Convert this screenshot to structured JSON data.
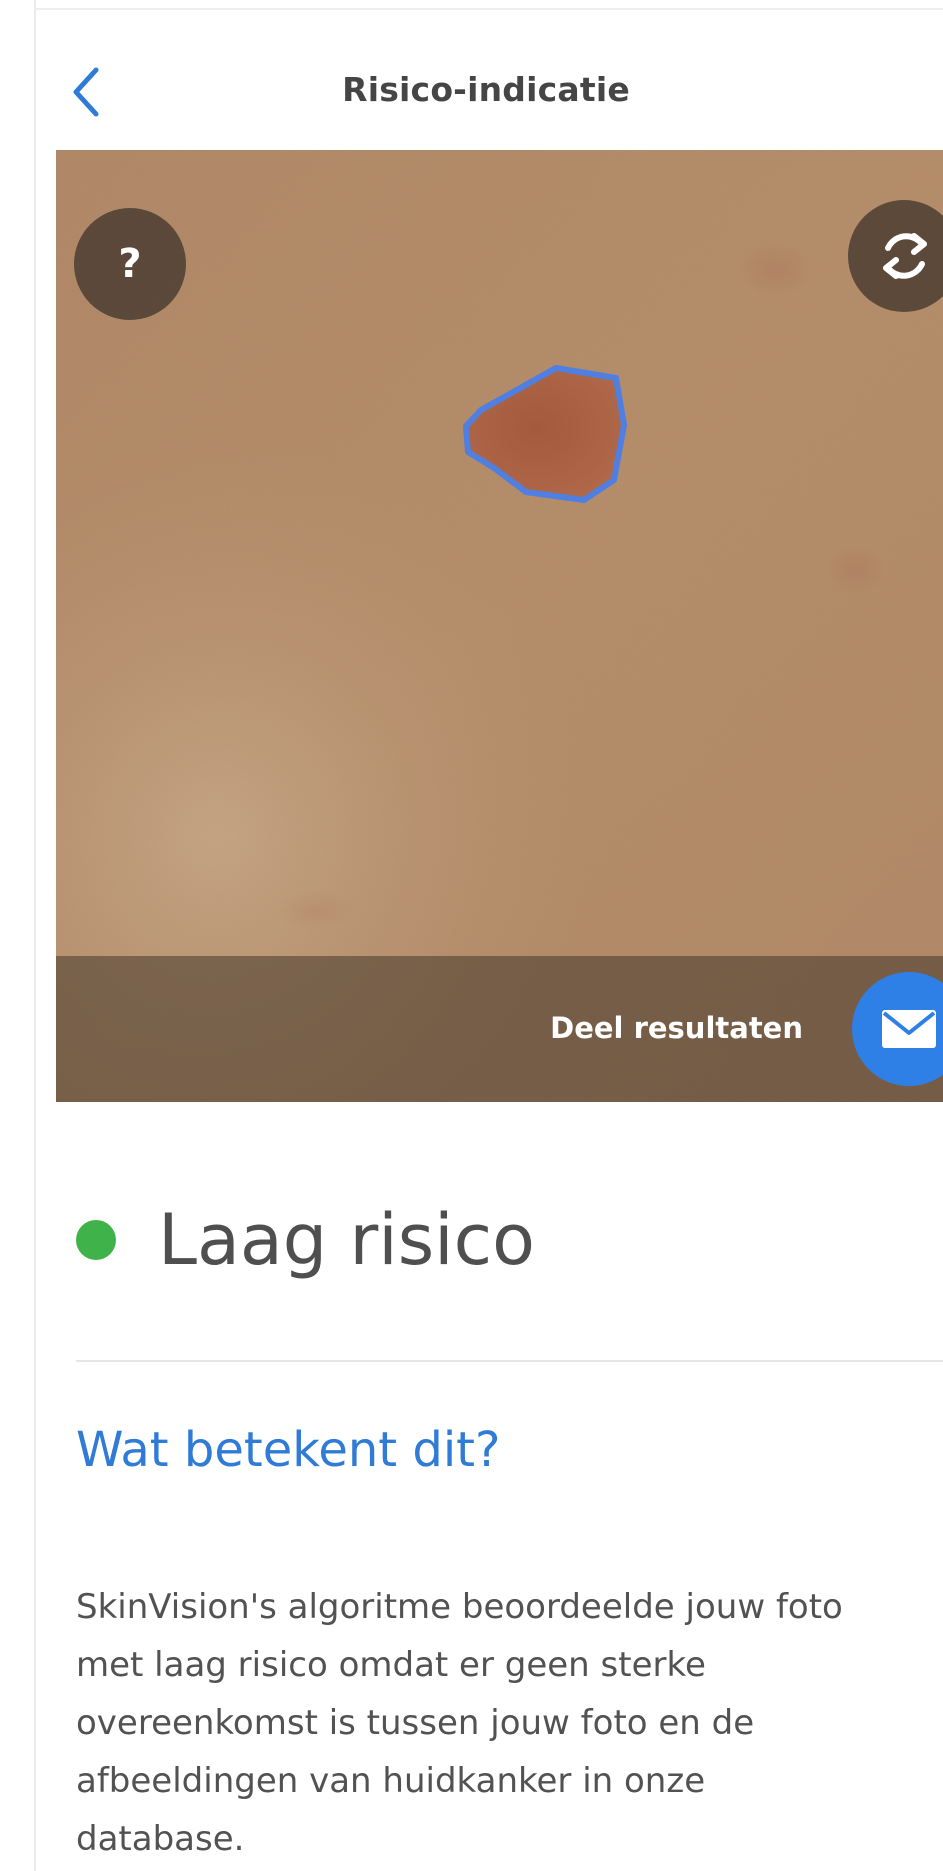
{
  "header": {
    "title": "Risico-indicatie",
    "back_icon": "chevron-left-icon"
  },
  "photo": {
    "help_glyph": "?",
    "help_icon": "help-icon",
    "refresh_icon": "refresh-icon",
    "share_label": "Deel resultaten",
    "share_icon": "mail-icon"
  },
  "result": {
    "risk_label": "Laag risico",
    "risk_color": "#3fb349",
    "section_title": "Wat betekent dit?",
    "description_lines": [
      "SkinVision's algoritme beoordeelde jouw foto",
      "met laag risico omdat er geen sterke",
      "overeenkomst is tussen jouw foto en de",
      "afbeeldingen van huidkanker in onze",
      "database."
    ]
  },
  "colors": {
    "accent": "#2f7bd6",
    "share_button": "#2f80e6",
    "outline": "#4f7fe0"
  }
}
